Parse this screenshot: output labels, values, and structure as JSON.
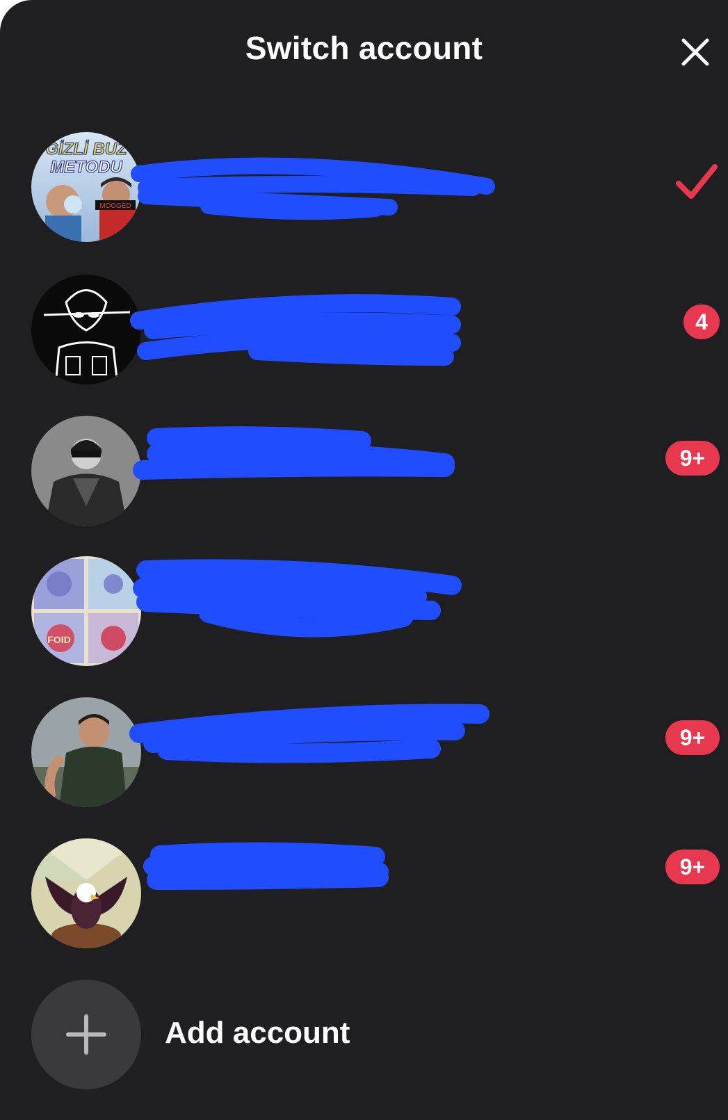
{
  "header": {
    "title": "Switch account"
  },
  "accounts": [
    {
      "avatar_text_top": "GİZLİ BUZ",
      "avatar_text_bottom": "METODU",
      "avatar_tag": "MOGGED",
      "status": "current",
      "badge": ""
    },
    {
      "status": "other",
      "badge": "4"
    },
    {
      "status": "other",
      "badge": "9+"
    },
    {
      "avatar_text": "FOID",
      "status": "other",
      "badge": ""
    },
    {
      "status": "other",
      "badge": "9+"
    },
    {
      "status": "other",
      "badge": "9+"
    }
  ],
  "add_account": {
    "label": "Add account"
  },
  "colors": {
    "background": "#1f1f21",
    "accent": "#e8384f",
    "redaction": "#1f4dff"
  },
  "icons": {
    "close": "close-icon",
    "current": "checkmark-icon",
    "add": "plus-icon"
  }
}
